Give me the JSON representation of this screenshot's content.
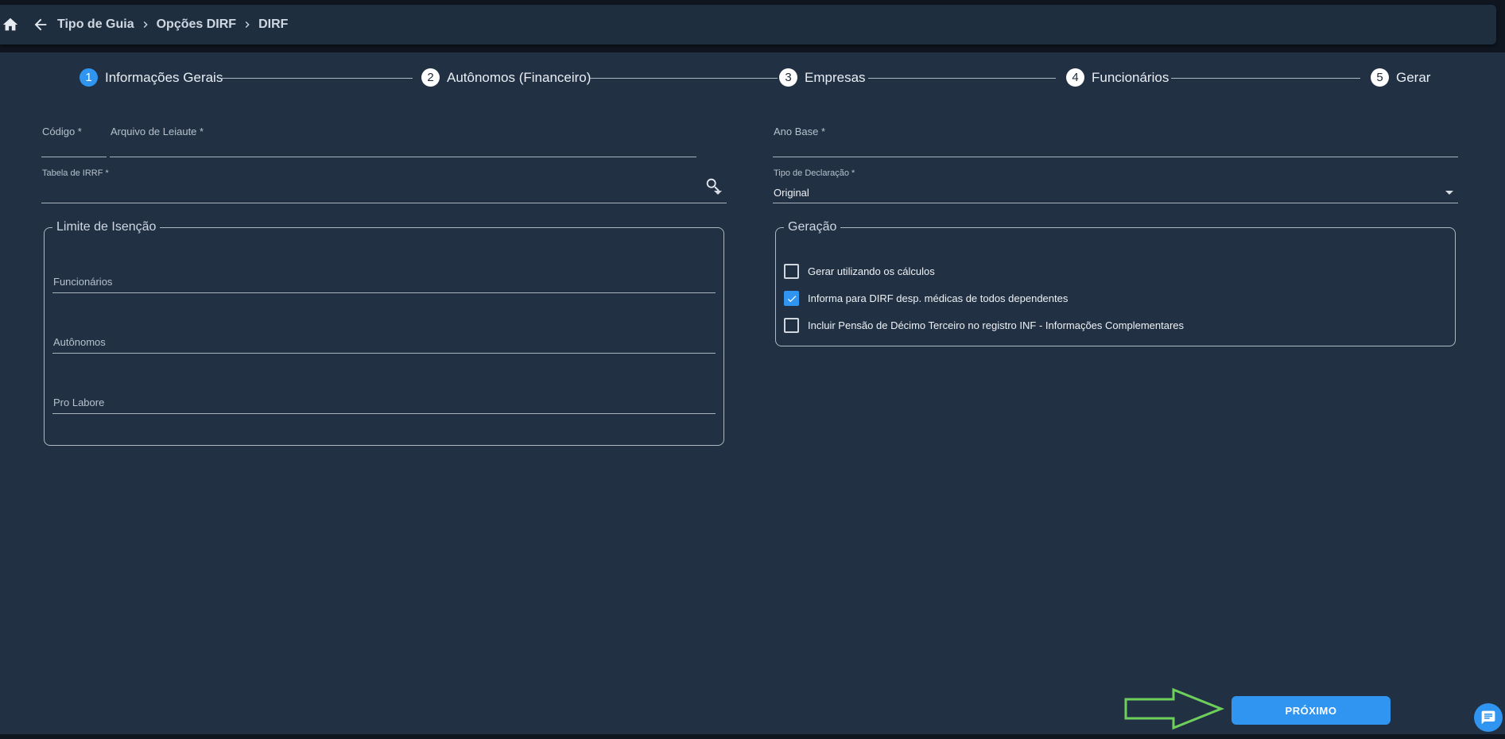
{
  "breadcrumb": {
    "items": [
      "Tipo de Guia",
      "Opções DIRF",
      "DIRF"
    ]
  },
  "stepper": {
    "steps": [
      {
        "number": "1",
        "label": "Informações Gerais",
        "active": true
      },
      {
        "number": "2",
        "label": "Autônomos (Financeiro)",
        "active": false
      },
      {
        "number": "3",
        "label": "Empresas",
        "active": false
      },
      {
        "number": "4",
        "label": "Funcionários",
        "active": false
      },
      {
        "number": "5",
        "label": "Gerar",
        "active": false
      }
    ]
  },
  "form": {
    "codigo_label": "Código *",
    "arquivo_label": "Arquivo de Leiaute *",
    "ano_base_label": "Ano Base *",
    "tabela_irrf_label": "Tabela de IRRF *",
    "tabela_irrf_value": "",
    "tipo_declaracao_label": "Tipo de Declaração *",
    "tipo_declaracao_value": "Original"
  },
  "limite": {
    "legend": "Limite de Isenção",
    "funcionarios_label": "Funcionários",
    "autonomos_label": "Autônomos",
    "pro_labore_label": "Pro Labore"
  },
  "geracao": {
    "legend": "Geração",
    "options": [
      {
        "label": "Gerar utilizando os cálculos",
        "checked": false
      },
      {
        "label": "Informa para DIRF desp. médicas de todos dependentes",
        "checked": true
      },
      {
        "label": "Incluir Pensão de Décimo Terceiro no registro INF - Informações Complementares",
        "checked": false
      }
    ]
  },
  "actions": {
    "next_label": "PRÓXIMO"
  },
  "colors": {
    "accent": "#2f95f0",
    "panel": "#213143",
    "hint_arrow": "#6fcf5b"
  },
  "icons": [
    "home-icon",
    "arrow-back-icon",
    "chevron-right-icon",
    "search-icon",
    "dropdown-caret-icon",
    "check-icon",
    "chat-icon"
  ]
}
